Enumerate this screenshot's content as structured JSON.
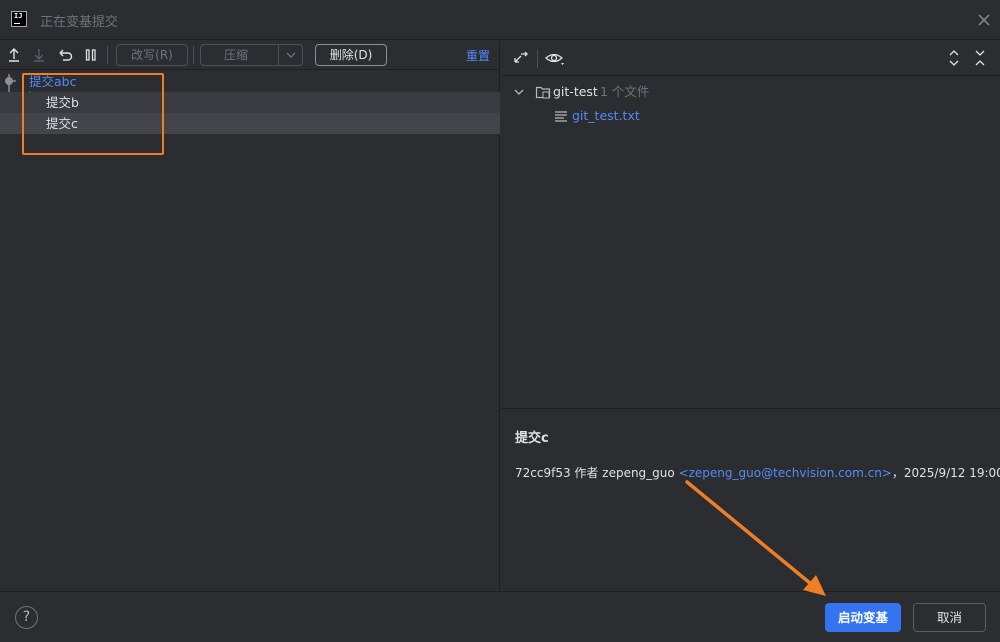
{
  "window": {
    "title": "正在变基提交",
    "logo_text": "IJ"
  },
  "left_toolbar": {
    "reword_label": "改写(R)",
    "squash_label": "压缩",
    "drop_label": "删除(D)",
    "reset_label": "重置"
  },
  "commits": [
    {
      "label": "提交abc",
      "state": "current"
    },
    {
      "label": "提交b",
      "state": "normal"
    },
    {
      "label": "提交c",
      "state": "selected"
    }
  ],
  "changes_tree": {
    "root_label": "git-test",
    "root_count": "1 个文件",
    "file_label": "git_test.txt"
  },
  "details": {
    "title": "提交c",
    "hash": "72cc9f53",
    "author_prefix": "作者",
    "author": "zepeng_guo",
    "email": "<zepeng_guo@techvision.com.cn>",
    "date": "，2025/9/12 19:00"
  },
  "footer": {
    "help_label": "?",
    "start_rebase_label": "启动变基",
    "cancel_label": "取消"
  },
  "colors": {
    "accent": "#3574f0",
    "link": "#548af7",
    "annotation": "#f07e26",
    "background": "#2b2d30"
  }
}
